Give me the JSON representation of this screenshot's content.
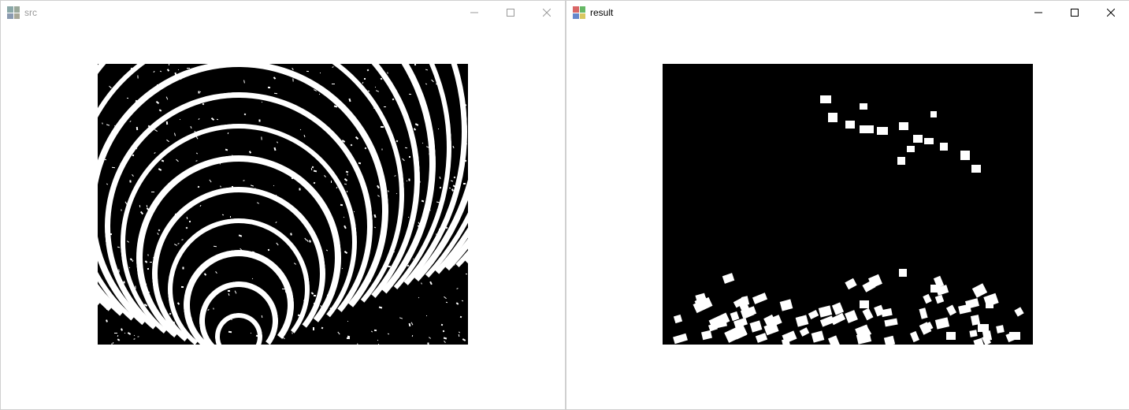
{
  "windows": {
    "src": {
      "title": "src",
      "active": false
    },
    "result": {
      "title": "result",
      "active": true
    }
  }
}
